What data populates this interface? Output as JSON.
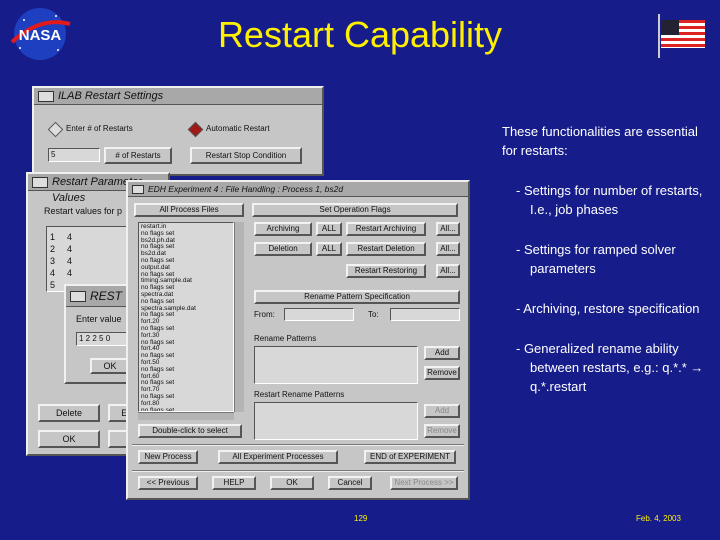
{
  "title": "Restart Capability",
  "logos": {
    "nasa_text": "NASA",
    "flag": "us-flag"
  },
  "colors": {
    "background": "#161d8a",
    "title": "#fff000",
    "text": "#ffffff",
    "window": "#c6c6c6"
  },
  "win1": {
    "title": "ILAB Restart Settings",
    "radio_enter": "Enter # of Restarts",
    "radio_auto": "Automatic Restart",
    "restarts_value": "5",
    "restarts_btn": "# of Restarts",
    "stop_btn": "Restart Stop Condition"
  },
  "win2": {
    "title": "Restart Parameter Values",
    "restart_values_label": "Restart values for p",
    "rows": [
      {
        "n": "1",
        "v": "4"
      },
      {
        "n": "2",
        "v": "4"
      },
      {
        "n": "3",
        "v": "4"
      },
      {
        "n": "4",
        "v": "4"
      },
      {
        "n": "5",
        "v": ""
      }
    ],
    "delete_btn": "Delete",
    "enter_btn": "Ent",
    "ok_btn": "OK"
  },
  "win3": {
    "title": "REST",
    "enter_label": "Enter value",
    "value": "1 2 2 5 0",
    "ok_btn": "OK"
  },
  "win4": {
    "title": "EDH Experiment 4 : File Handling : Process 1, bs2d",
    "all_process_files": "All Process Files",
    "set_operation_flags": "Set Operation Flags",
    "files": [
      "restart.in",
      "  no flags set",
      "bs2d.ph.dat",
      "  no flags set",
      "bs2d.dat",
      "  no flags set",
      "output.dat",
      "  no flags set",
      "timing.sample.dat",
      "  no flags set",
      "spectra.dat",
      "  no flags set",
      "spectra.sample.dat",
      "  no flags set",
      "fort.20",
      "  no flags set",
      "fort.30",
      "  no flags set",
      "fort.40",
      "  no flags set",
      "fort.50",
      "  no flags set",
      "fort.60",
      "  no flags set",
      "fort.70",
      "  no flags set",
      "fort.80",
      "  no flags set"
    ],
    "archiving": "Archiving",
    "all1": "ALL",
    "restart_archiving": "Restart Archiving",
    "dots1": "All...",
    "deletion": "Deletion",
    "all2": "ALL",
    "restart_deletion": "Restart Deletion",
    "dots2": "All...",
    "restart_restoring": "Restart Restoring",
    "dots3": "All...",
    "rename_pattern_spec": "Rename Pattern Specification",
    "from_label": "From:",
    "to_label": "To:",
    "rename_patterns_label": "Rename Patterns",
    "add1": "Add",
    "remove1": "Remove",
    "restart_rename_label": "Restart Rename Patterns",
    "add2": "Add",
    "remove2": "Remove",
    "double_click": "Double-click to select",
    "new_process": "New Process",
    "all_exp_processes": "All Experiment Processes",
    "end_experiment": "END of EXPERIMENT",
    "prev_process": "<< Previous",
    "help": "HELP",
    "ok": "OK",
    "cancel": "Cancel",
    "next_process": "Next Process >>"
  },
  "bullets": {
    "intro": "These functionalities are essential for restarts:",
    "items": [
      "- Settings for number of restarts, I.e., job phases",
      "- Settings for ramped solver parameters",
      "- Archiving, restore specification",
      "- Generalized rename ability between restarts, e.g.: q.*.* → q.*.restart"
    ]
  },
  "footer": {
    "page": "129",
    "date": "Feb. 4, 2003"
  }
}
